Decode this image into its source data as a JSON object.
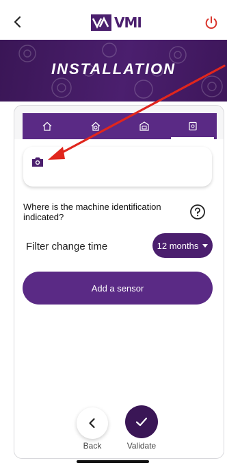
{
  "header": {
    "brand_name": "VMI",
    "brand_color": "#4b1f6e",
    "power_color": "#d9342b",
    "back_icon": "chevron-left-icon",
    "power_icon": "power-icon"
  },
  "banner": {
    "title": "INSTALLATION"
  },
  "tabs": [
    {
      "icon": "home-icon",
      "active": false
    },
    {
      "icon": "settings-house-icon",
      "active": false
    },
    {
      "icon": "machine-icon",
      "active": false
    },
    {
      "icon": "sensor-icon",
      "active": true
    }
  ],
  "form": {
    "camera_icon": "camera-icon",
    "question": "Where is the machine identification indicated?",
    "help_icon": "help-circle-icon",
    "filter_label": "Filter change time",
    "filter_value": "12 months",
    "add_sensor_label": "Add a sensor"
  },
  "footer": {
    "back_label": "Back",
    "validate_label": "Validate"
  },
  "colors": {
    "primary": "#5a2a85",
    "dark": "#3a1656",
    "annotation_arrow": "#e0261d"
  }
}
